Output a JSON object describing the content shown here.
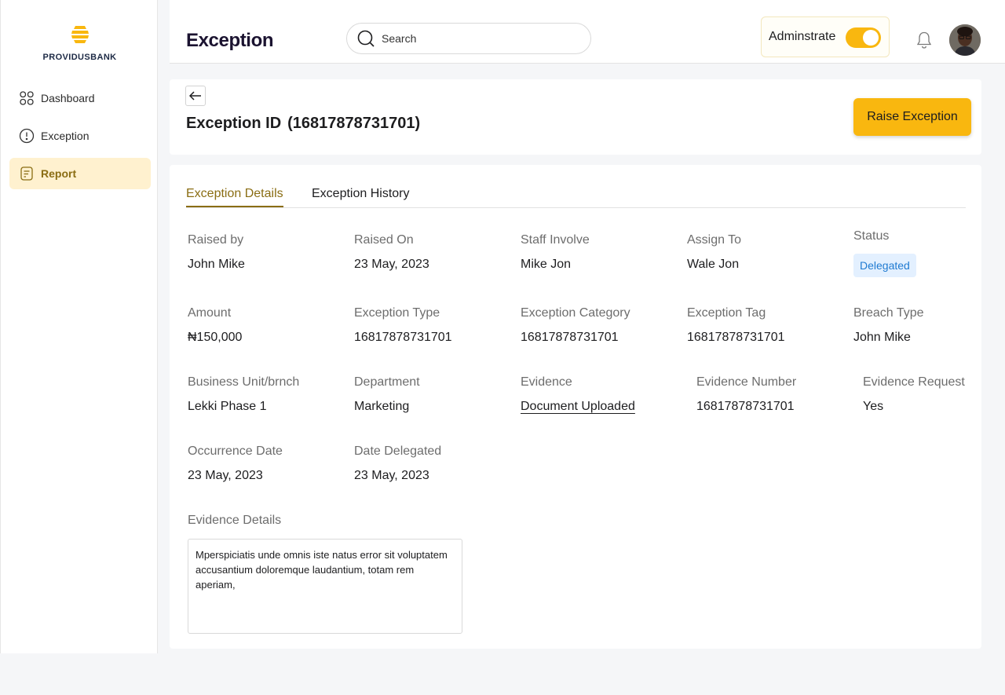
{
  "sidebar": {
    "brand": "PROVIDUSBANK",
    "items": [
      {
        "label": "Dashboard",
        "icon": "dashboard-grid-icon"
      },
      {
        "label": "Exception",
        "icon": "alert-circle-icon"
      },
      {
        "label": "Report",
        "icon": "report-document-icon",
        "active": true
      }
    ]
  },
  "header": {
    "title": "Exception",
    "search_placeholder": "Search",
    "admin_label": "Adminstrate",
    "admin_toggle_on": true
  },
  "exception": {
    "id_label": "Exception ID",
    "id_value": "(16817878731701)",
    "raise_button": "Raise Exception"
  },
  "tabs": [
    {
      "label": "Exception Details",
      "active": true
    },
    {
      "label": "Exception History",
      "active": false
    }
  ],
  "details": {
    "raised_by": {
      "label": "Raised  by",
      "value": "John Mike"
    },
    "raised_on": {
      "label": "Raised On",
      "value": "23 May, 2023"
    },
    "staff_involve": {
      "label": "Staff Involve",
      "value": "Mike Jon"
    },
    "assign_to": {
      "label": "Assign To",
      "value": "Wale Jon"
    },
    "status": {
      "label": "Status",
      "value": "Delegated"
    },
    "amount": {
      "label": "Amount",
      "value": "₦150,000"
    },
    "exception_type": {
      "label": "Exception Type",
      "value": "16817878731701"
    },
    "exception_category": {
      "label": "Exception Category",
      "value": "16817878731701"
    },
    "exception_tag": {
      "label": "Exception Tag",
      "value": "16817878731701"
    },
    "breach_type": {
      "label": "Breach Type",
      "value": "John Mike"
    },
    "business_unit": {
      "label": "Business Unit/brnch",
      "value": "Lekki Phase 1"
    },
    "department": {
      "label": "Department",
      "value": "Marketing"
    },
    "evidence": {
      "label": "Evidence",
      "value": "Document Uploaded"
    },
    "evidence_number": {
      "label": "Evidence Number",
      "value": "16817878731701"
    },
    "evidence_request": {
      "label": "Evidence Request",
      "value": "Yes"
    },
    "occurrence_date": {
      "label": "Occurrence Date",
      "value": "23 May, 2023"
    },
    "date_delegated": {
      "label": "Date Delegated",
      "value": "23 May, 2023"
    },
    "evidence_details": {
      "label": "Evidence Details",
      "value": "Mperspiciatis unde omnis iste natus error sit voluptatem accusantium doloremque laudantium, totam rem aperiam,"
    }
  },
  "colors": {
    "accent": "#f9b70f",
    "accent_text": "#8a6d13",
    "status_badge_bg": "#e3f0ff",
    "status_badge_text": "#1f7ad1"
  }
}
